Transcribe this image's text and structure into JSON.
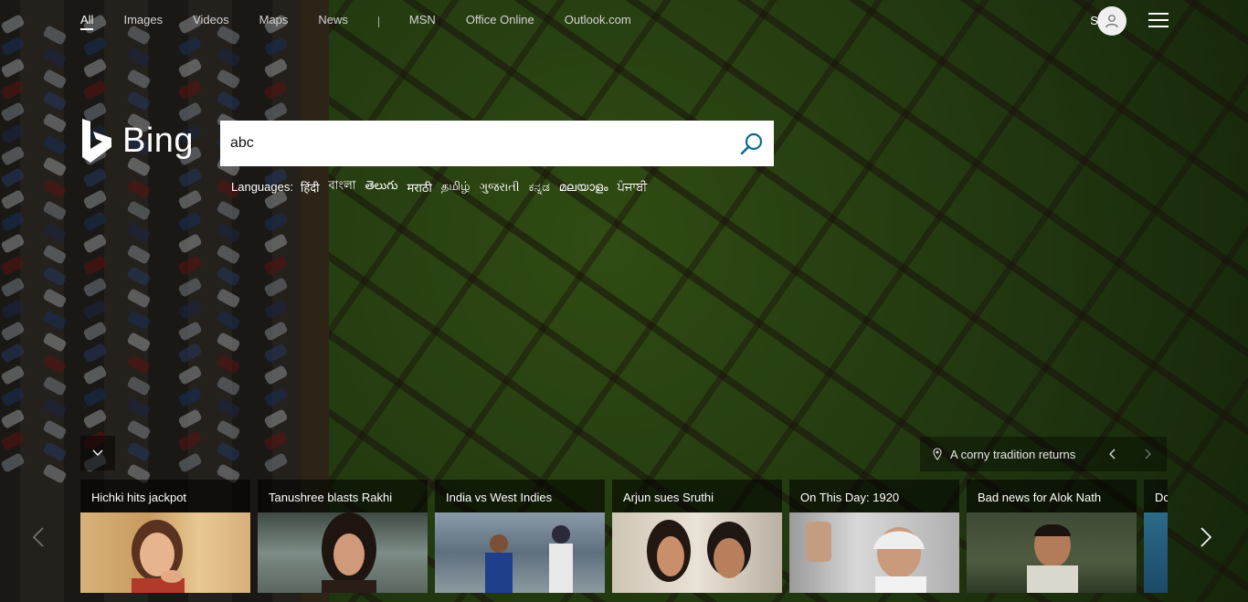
{
  "topnav": {
    "items": [
      {
        "label": "All",
        "active": true
      },
      {
        "label": "Images"
      },
      {
        "label": "Videos"
      },
      {
        "label": "Maps"
      },
      {
        "label": "News"
      }
    ],
    "external": [
      {
        "label": "MSN"
      },
      {
        "label": "Office Online"
      },
      {
        "label": "Outlook.com"
      }
    ]
  },
  "account": {
    "signin_label": "Sign in",
    "avatar_icon": "user-icon",
    "menu_icon": "hamburger-icon"
  },
  "logo": {
    "text": "Bing"
  },
  "search": {
    "value": "abc",
    "icon": "search-icon"
  },
  "languages": {
    "label": "Languages:",
    "items": [
      "हिंदी",
      "বাংলা",
      "తెలుగు",
      "मराठी",
      "தமிழ்",
      "ગુજરાતી",
      "ಕನ್ನಡ",
      "മലയാളം",
      "ਪੰਜਾਬੀ"
    ]
  },
  "image_caption": {
    "text": "A corny tradition returns",
    "icon": "location-pin-icon"
  },
  "carousel": {
    "cards": [
      {
        "title": "Hichki hits jackpot"
      },
      {
        "title": "Tanushree blasts Rakhi"
      },
      {
        "title": "India vs West Indies"
      },
      {
        "title": "Arjun sues Sruthi"
      },
      {
        "title": "On This Day: 1920"
      },
      {
        "title": "Bad news for Alok Nath"
      },
      {
        "title": "Dc"
      }
    ]
  },
  "colors": {
    "search_icon": "#0b6a8f",
    "accent": "#ffffff"
  }
}
